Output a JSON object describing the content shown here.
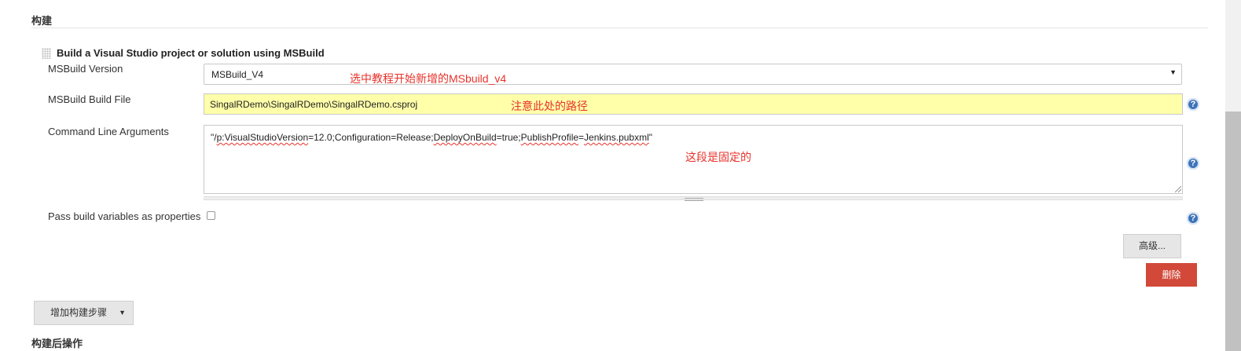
{
  "build_section": {
    "title": "构建"
  },
  "msbuild_step": {
    "title": "Build a Visual Studio project or solution using MSBuild",
    "msbuild_version": {
      "label": "MSBuild Version",
      "value": "MSBuild_V4"
    },
    "build_file": {
      "label": "MSBuild Build File",
      "value": "SingalRDemo\\SingalRDemo\\SingalRDemo.csproj"
    },
    "command_args": {
      "label": "Command Line Arguments",
      "value_parts": [
        "\"/",
        "p:VisualStudioVersion",
        "=12.0;Configuration=Release;",
        "DeployOnBuild",
        "=true;",
        "PublishProfile",
        "=",
        "Jenkins.pubxml",
        "\""
      ]
    },
    "pass_build_vars": {
      "label": "Pass build variables as properties",
      "checked": false
    },
    "advanced_label": "高级...",
    "delete_label": "删除"
  },
  "add_build_step_label": "增加构建步骤",
  "post_build_section": {
    "title": "构建后操作"
  },
  "annotations": {
    "version_note": "选中教程开始新增的MSbuild_v4",
    "path_note": "注意此处的路径",
    "args_note": "这段是固定的"
  },
  "help_icon_glyph": "?",
  "colors": {
    "delete_button": "#d24939",
    "input_highlight": "#ffffaa",
    "annotation": "#e8322b",
    "help_icon": "#3d73b8"
  }
}
